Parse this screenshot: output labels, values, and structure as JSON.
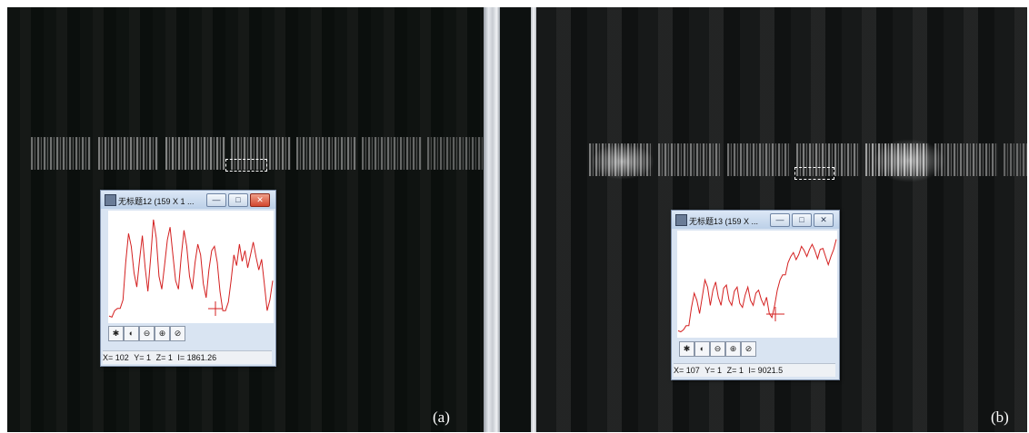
{
  "panels": [
    {
      "label": "(a)",
      "plot_window": {
        "title": "无标题12 (159 X 1 ...",
        "buttons": {
          "minimize": "—",
          "maximize": "□",
          "close": "✕"
        },
        "status": {
          "x": "X= 102",
          "y": "Y= 1",
          "z": "Z= 1",
          "i": "I= 1861.26"
        },
        "profile": [
          0.05,
          0.04,
          0.1,
          0.12,
          0.12,
          0.2,
          0.55,
          0.82,
          0.7,
          0.45,
          0.32,
          0.58,
          0.8,
          0.5,
          0.28,
          0.6,
          0.95,
          0.78,
          0.42,
          0.3,
          0.52,
          0.76,
          0.88,
          0.62,
          0.38,
          0.3,
          0.6,
          0.85,
          0.7,
          0.42,
          0.3,
          0.55,
          0.72,
          0.62,
          0.35,
          0.22,
          0.48,
          0.66,
          0.7,
          0.55,
          0.28,
          0.1,
          0.1,
          0.18,
          0.38,
          0.62,
          0.52,
          0.72,
          0.56,
          0.66,
          0.5,
          0.62,
          0.74,
          0.6,
          0.48,
          0.58,
          0.35,
          0.1,
          0.2,
          0.38
        ]
      }
    },
    {
      "label": "(b)",
      "plot_window": {
        "title": "无标题13 (159 X ...",
        "buttons": {
          "minimize": "—",
          "maximize": "□",
          "close": "✕"
        },
        "status": {
          "x": "X= 107",
          "y": "Y= 1",
          "z": "Z= 1",
          "i": "I= 9021.5"
        },
        "profile": [
          0.05,
          0.04,
          0.06,
          0.1,
          0.1,
          0.28,
          0.42,
          0.35,
          0.22,
          0.38,
          0.55,
          0.48,
          0.3,
          0.45,
          0.53,
          0.38,
          0.3,
          0.47,
          0.5,
          0.35,
          0.3,
          0.44,
          0.48,
          0.32,
          0.28,
          0.4,
          0.48,
          0.35,
          0.3,
          0.42,
          0.45,
          0.36,
          0.3,
          0.38,
          0.22,
          0.18,
          0.3,
          0.45,
          0.55,
          0.6,
          0.6,
          0.72,
          0.78,
          0.82,
          0.75,
          0.8,
          0.88,
          0.84,
          0.78,
          0.85,
          0.9,
          0.84,
          0.76,
          0.85,
          0.86,
          0.78,
          0.7,
          0.78,
          0.85,
          0.95
        ]
      }
    }
  ],
  "toolbar_icons": [
    "scale-icon",
    "contrast-icon",
    "zoom-out-icon",
    "zoom-in-icon",
    "zoom-reset-icon"
  ],
  "colors": {
    "profile_line": "#d42020",
    "background": "#0b0f0d"
  }
}
